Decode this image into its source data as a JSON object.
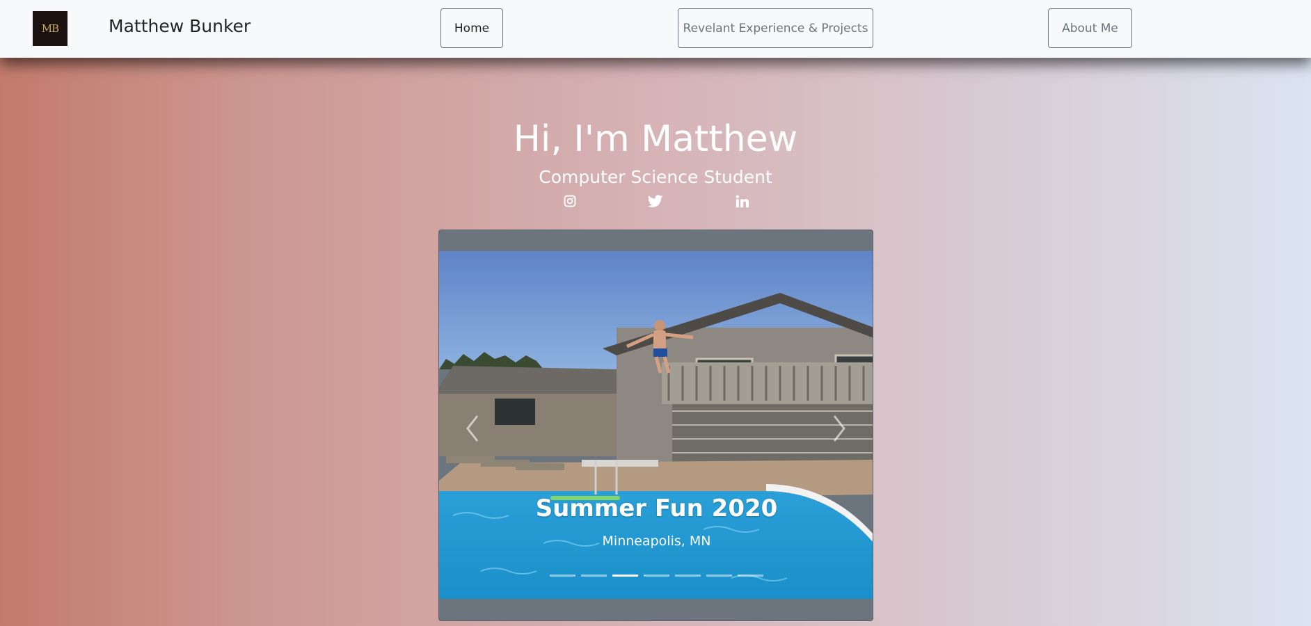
{
  "nav": {
    "brand_logo_text": "MB",
    "brand_name": "Matthew Bunker",
    "items": [
      {
        "label": "Home",
        "active": true
      },
      {
        "label": "Revelant Experience & Projects",
        "active": false
      },
      {
        "label": "About Me",
        "active": false
      }
    ]
  },
  "hero": {
    "title": "Hi, I'm Matthew",
    "subtitle": "Computer Science Student",
    "social_icons": [
      "instagram-icon",
      "twitter-icon",
      "linkedin-icon"
    ]
  },
  "carousel": {
    "caption_title": "Summer Fun 2020",
    "caption_subtitle": "Minneapolis, MN",
    "slide_count": 7,
    "active_index": 2
  },
  "colors": {
    "navbar_bg": "#f8f9fa",
    "gradient_left": "#c37b6c",
    "gradient_right": "#dbe4f2",
    "carousel_bg": "#6c757d",
    "text_white": "#ffffff"
  }
}
